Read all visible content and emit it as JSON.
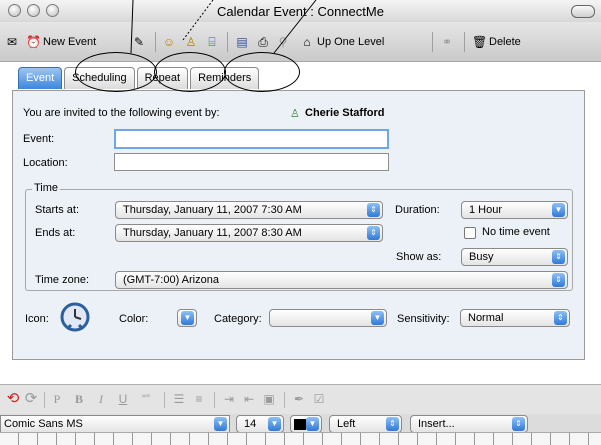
{
  "window": {
    "title": "Calendar Event : ConnectMe"
  },
  "toolbar": {
    "new_event": "New Event",
    "up_one_level": "Up One Level",
    "delete": "Delete"
  },
  "tabs": [
    {
      "label": "Event",
      "active": true
    },
    {
      "label": "Scheduling",
      "active": false
    },
    {
      "label": "Repeat",
      "active": false
    },
    {
      "label": "Reminders",
      "active": false
    }
  ],
  "invite": {
    "text": "You are invited to the following event by:",
    "organizer": "Cherie Stafford"
  },
  "fields": {
    "event_label": "Event:",
    "event_value": "",
    "location_label": "Location:",
    "location_value": ""
  },
  "time": {
    "group_label": "Time",
    "starts_label": "Starts at:",
    "starts_value": "Thursday, January 11, 2007 7:30 AM",
    "ends_label": "Ends at:",
    "ends_value": "Thursday, January 11, 2007 8:30 AM",
    "duration_label": "Duration:",
    "duration_value": "1 Hour",
    "no_time_label": "No time event",
    "show_as_label": "Show as:",
    "show_as_value": "Busy",
    "timezone_label": "Time zone:",
    "timezone_value": "(GMT-7:00) Arizona"
  },
  "props": {
    "icon_label": "Icon:",
    "color_label": "Color:",
    "category_label": "Category:",
    "category_value": "",
    "sensitivity_label": "Sensitivity:",
    "sensitivity_value": "Normal"
  },
  "format": {
    "font": "Comic Sans MS",
    "size": "14",
    "align": "Left",
    "insert": "Insert...",
    "buttons": [
      "P",
      "B",
      "I",
      "U",
      "“”"
    ]
  },
  "colors": {
    "accent": "#3d86de",
    "panel": "#ecf1f7"
  }
}
